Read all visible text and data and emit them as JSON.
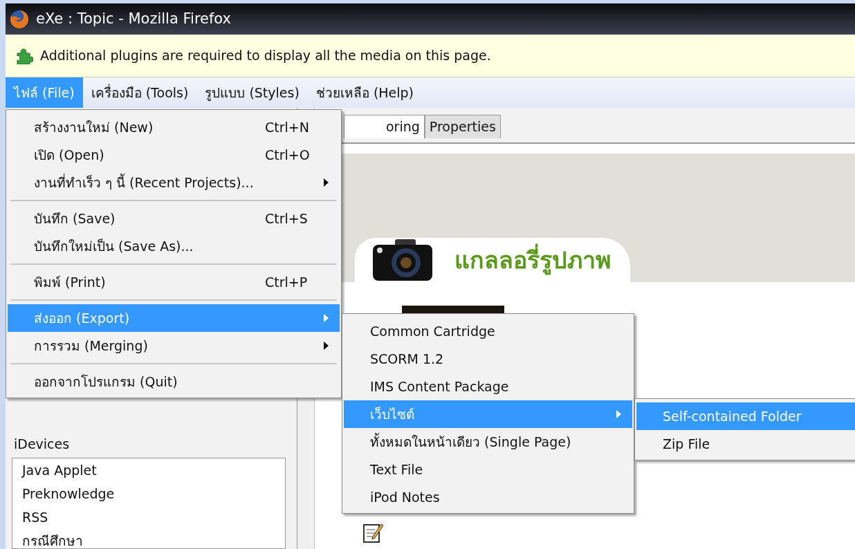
{
  "window": {
    "title": "eXe : Topic - Mozilla Firefox"
  },
  "notification": {
    "text": "Additional plugins are required to display all the media on this page."
  },
  "menubar": [
    {
      "label": "ไฟล์ (File)",
      "selected": true
    },
    {
      "label": "เครื่องมือ (Tools)",
      "selected": false
    },
    {
      "label": "รูปแบบ (Styles)",
      "selected": false
    },
    {
      "label": "ช่วยเหลือ (Help)",
      "selected": false
    }
  ],
  "file_menu": [
    {
      "kind": "item",
      "label": "สร้างงานใหม่ (New)",
      "shortcut": "Ctrl+N",
      "submenu": false,
      "selected": false
    },
    {
      "kind": "item",
      "label": "เปิด (Open)",
      "shortcut": "Ctrl+O",
      "submenu": false,
      "selected": false
    },
    {
      "kind": "item",
      "label": "งานที่ทำเร็ว ๆ นี้ (Recent Projects)...",
      "submenu": true,
      "selected": false
    },
    {
      "kind": "separator"
    },
    {
      "kind": "item",
      "label": "บันทึก (Save)",
      "shortcut": "Ctrl+S",
      "submenu": false,
      "selected": false
    },
    {
      "kind": "item",
      "label": "บันทึกใหม่เป็น (Save As)...",
      "submenu": false,
      "selected": false
    },
    {
      "kind": "separator"
    },
    {
      "kind": "item",
      "label": "พิมพ์ (Print)",
      "shortcut": "Ctrl+P",
      "submenu": false,
      "selected": false
    },
    {
      "kind": "separator"
    },
    {
      "kind": "item",
      "label": "ส่งออก (Export)",
      "submenu": true,
      "selected": true
    },
    {
      "kind": "item",
      "label": "การรวม (Merging)",
      "submenu": true,
      "selected": false
    },
    {
      "kind": "separator"
    },
    {
      "kind": "item",
      "label": "ออกจากโปรแกรม (Quit)",
      "submenu": false,
      "selected": false
    }
  ],
  "export_menu": [
    {
      "kind": "item",
      "label": "Common Cartridge",
      "submenu": false,
      "selected": false
    },
    {
      "kind": "item",
      "label": "SCORM 1.2",
      "submenu": false,
      "selected": false
    },
    {
      "kind": "item",
      "label": "IMS Content Package",
      "submenu": false,
      "selected": false
    },
    {
      "kind": "item",
      "label": "เว็บไซต์",
      "submenu": true,
      "selected": true
    },
    {
      "kind": "item",
      "label": "ทั้งหมดในหน้าเดียว (Single Page)",
      "submenu": false,
      "selected": false
    },
    {
      "kind": "item",
      "label": "Text File",
      "submenu": false,
      "selected": false
    },
    {
      "kind": "item",
      "label": "iPod Notes",
      "submenu": false,
      "selected": false
    }
  ],
  "website_menu": [
    {
      "kind": "item",
      "label": "Self-contained Folder",
      "submenu": false,
      "selected": true
    },
    {
      "kind": "item",
      "label": "Zip File",
      "submenu": false,
      "selected": false
    }
  ],
  "tabs": [
    {
      "label": "oring",
      "selected": true
    },
    {
      "label": "Properties",
      "selected": false
    }
  ],
  "content": {
    "heading": "แกลลอรี่รูปภาพ"
  },
  "sidebar": {
    "idevices_label": "iDevices",
    "idevices": [
      "Java Applet",
      "Preknowledge",
      "RSS",
      "กรณีศึกษา"
    ]
  }
}
